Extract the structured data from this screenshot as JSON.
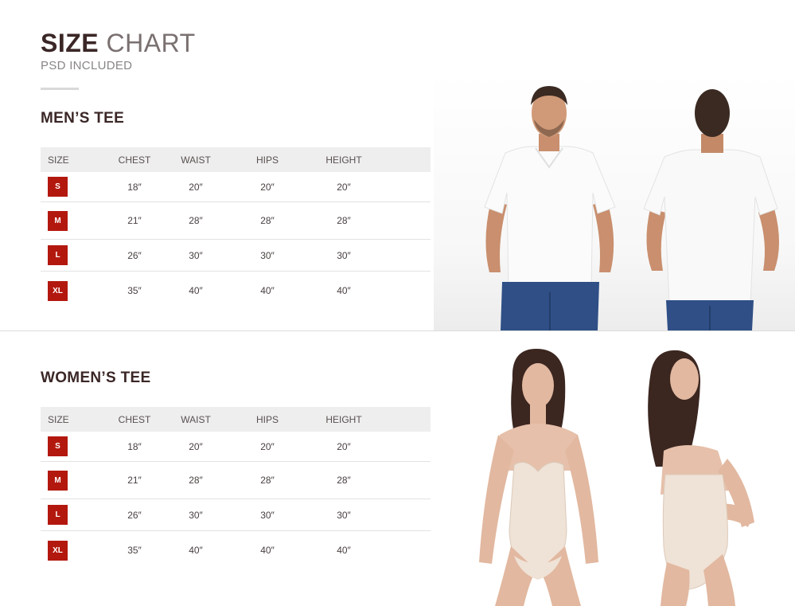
{
  "header": {
    "title_bold": "SIZE",
    "title_light": "CHART",
    "subtitle": "PSD INCLUDED"
  },
  "columns": [
    "SIZE",
    "CHEST",
    "WAIST",
    "HIPS",
    "HEIGHT"
  ],
  "men": {
    "title": "MEN’S TEE",
    "rows": [
      {
        "size": "S",
        "chest": "18″",
        "waist": "20″",
        "hips": "20″",
        "height": "20″"
      },
      {
        "size": "M",
        "chest": "21″",
        "waist": "28″",
        "hips": "28″",
        "height": "28″"
      },
      {
        "size": "L",
        "chest": "26″",
        "waist": "30″",
        "hips": "30″",
        "height": "30″"
      },
      {
        "size": "XL",
        "chest": "35″",
        "waist": "40″",
        "hips": "40″",
        "height": "40″"
      }
    ]
  },
  "women": {
    "title": "WOMEN’S TEE",
    "rows": [
      {
        "size": "S",
        "chest": "18″",
        "waist": "20″",
        "hips": "20″",
        "height": "20″"
      },
      {
        "size": "M",
        "chest": "21″",
        "waist": "28″",
        "hips": "28″",
        "height": "28″"
      },
      {
        "size": "L",
        "chest": "26″",
        "waist": "30″",
        "hips": "30″",
        "height": "30″"
      },
      {
        "size": "XL",
        "chest": "35″",
        "waist": "40″",
        "hips": "40″",
        "height": "40″"
      }
    ]
  },
  "colors": {
    "badge": "#b3180f",
    "heading": "#3b2626",
    "table_header_bg": "#eeeeee"
  }
}
